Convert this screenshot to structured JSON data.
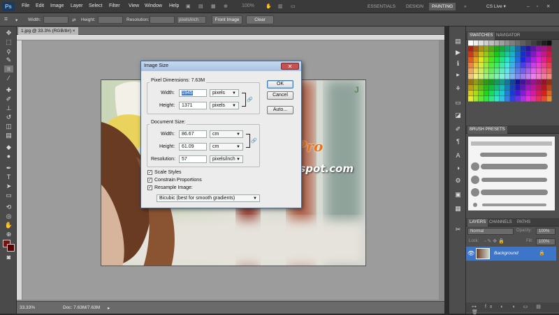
{
  "app": {
    "logo": "Ps",
    "menus": [
      "File",
      "Edit",
      "Image",
      "Layer",
      "Select",
      "Filter",
      "View",
      "Window",
      "Help"
    ],
    "zoom": "100%",
    "workspaces": [
      "ESSENTIALS",
      "DESIGN",
      "PAINTING"
    ],
    "active_workspace": "PAINTING",
    "cs_live": "CS Live"
  },
  "options": {
    "width_label": "Width:",
    "height_label": "Height:",
    "resolution_label": "Resolution:",
    "resolution_unit": "pixels/inch",
    "front_image": "Front Image",
    "clear": "Clear"
  },
  "document": {
    "tab_label": "1.jpg @ 33.3% (RGB/8#)",
    "zoom_status": "33.33%",
    "doc_status": "Doc: 7.63M/7.63M"
  },
  "watermark": {
    "title": "Kênh Việt Pro",
    "url": "kenhvietpro.blogspot.com"
  },
  "dialog": {
    "title": "Image Size",
    "pixel_dimensions_label": "Pixel Dimensions:",
    "pixel_dimensions_value": "7.63M",
    "width_label": "Width:",
    "height_label": "Height:",
    "px_width": "1945",
    "px_height": "1371",
    "px_unit": "pixels",
    "document_size_label": "Document Size:",
    "doc_width": "86.67",
    "doc_height": "61.09",
    "doc_unit": "cm",
    "resolution_label": "Resolution:",
    "resolution": "57",
    "resolution_unit": "pixels/inch",
    "scale_styles": "Scale Styles",
    "constrain": "Constrain Proportions",
    "resample": "Resample Image:",
    "resample_method": "Bicubic (best for smooth gradients)",
    "ok": "OK",
    "cancel": "Cancel",
    "auto": "Auto...",
    "checks": {
      "scale_styles": true,
      "constrain": true,
      "resample": true
    }
  },
  "panels": {
    "swatches_tab": "SWATCHES",
    "navigator_tab": "NAVIGATOR",
    "brush_presets_tab": "BRUSH PRESETS",
    "layers_tab": "LAYERS",
    "channels_tab": "CHANNELS",
    "paths_tab": "PATHS",
    "blend_mode": "Normal",
    "opacity_label": "Opacity:",
    "opacity_value": "100%",
    "lock_label": "Lock:",
    "fill_label": "Fill:",
    "fill_value": "100%",
    "layer_name": "Background"
  },
  "colors": {
    "foreground": "#7a1010",
    "background": "#5a0000",
    "accent": "#3d76c8"
  }
}
